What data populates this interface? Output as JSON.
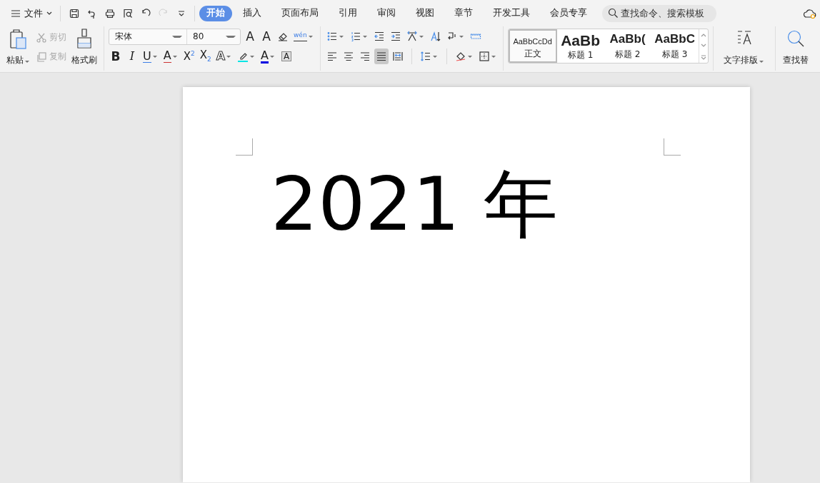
{
  "menu": {
    "label": "文件"
  },
  "quick_access": [
    {
      "kind": "save",
      "disabled": false
    },
    {
      "kind": "share",
      "disabled": false
    },
    {
      "kind": "print",
      "disabled": false
    },
    {
      "kind": "preview",
      "disabled": false
    },
    {
      "kind": "undo",
      "disabled": false
    },
    {
      "kind": "redo",
      "disabled": true
    },
    {
      "kind": "customize",
      "disabled": false
    }
  ],
  "tabs": [
    {
      "label": "开始",
      "selected": true
    },
    {
      "label": "插入",
      "selected": false
    },
    {
      "label": "页面布局",
      "selected": false
    },
    {
      "label": "引用",
      "selected": false
    },
    {
      "label": "审阅",
      "selected": false
    },
    {
      "label": "视图",
      "selected": false
    },
    {
      "label": "章节",
      "selected": false
    },
    {
      "label": "开发工具",
      "selected": false
    },
    {
      "label": "会员专享",
      "selected": false
    }
  ],
  "search": {
    "placeholder": "查找命令、搜索模板"
  },
  "clipboard": {
    "paste": "粘贴",
    "cut": {
      "label": "剪切",
      "disabled": true
    },
    "copy": {
      "label": "复制",
      "disabled": true
    },
    "format_painter": "格式刷"
  },
  "font": {
    "name": "宋体",
    "size": "80"
  },
  "font_tools": [
    [
      {
        "kind": "grow",
        "glyph": "A",
        "dropdown": false
      },
      {
        "kind": "shrink",
        "glyph": "A",
        "dropdown": false
      },
      {
        "kind": "eraser",
        "dropdown": false
      },
      {
        "kind": "pinyin",
        "glyph": "wén",
        "dropdown": true
      }
    ],
    [
      {
        "kind": "bold",
        "glyph": "B",
        "dropdown": false
      },
      {
        "kind": "italic",
        "glyph": "I",
        "dropdown": false
      },
      {
        "kind": "underline",
        "glyph": "U",
        "dropdown": true
      },
      {
        "kind": "strike",
        "glyph": "A",
        "dropdown": true
      },
      {
        "kind": "super",
        "glyph": "X$^{2}$",
        "dropdown": false
      },
      {
        "kind": "sub",
        "glyph": "X$_{2}$",
        "dropdown": false
      },
      {
        "kind": "outline",
        "glyph": "A",
        "dropdown": true
      },
      {
        "kind": "highlight",
        "dropdown": true
      },
      {
        "kind": "color",
        "glyph": "A",
        "dropdown": true
      },
      {
        "kind": "shade",
        "glyph": "A",
        "dropdown": false
      }
    ]
  ],
  "paragraph_tools": [
    [
      {
        "kind": "bullets",
        "dropdown": true,
        "selected": false
      },
      {
        "kind": "numbering",
        "dropdown": true,
        "selected": false
      },
      {
        "kind": "outdent",
        "dropdown": false,
        "selected": false
      },
      {
        "kind": "indent",
        "dropdown": false,
        "selected": false
      },
      {
        "kind": "asian",
        "dropdown": true,
        "selected": false
      },
      {
        "kind": "sort",
        "dropdown": false,
        "selected": false
      },
      {
        "kind": "marks",
        "dropdown": true,
        "selected": false
      },
      {
        "kind": "ruler",
        "dropdown": false,
        "selected": false
      }
    ],
    [
      {
        "kind": "left",
        "dropdown": false,
        "selected": false
      },
      {
        "kind": "center",
        "dropdown": false,
        "selected": false
      },
      {
        "kind": "right",
        "dropdown": false,
        "selected": false
      },
      {
        "kind": "justify",
        "dropdown": false,
        "selected": true
      },
      {
        "kind": "distribute",
        "dropdown": false,
        "selected": false
      },
      {
        "kind": "spacing",
        "dropdown": true,
        "selected": false
      },
      {
        "kind": "fill",
        "dropdown": true,
        "selected": false
      },
      {
        "kind": "borders",
        "dropdown": true,
        "selected": false
      }
    ]
  ],
  "styles": [
    {
      "sample": "AaBbCcDd",
      "label": "正文",
      "selected": true
    },
    {
      "sample": "AaBb",
      "label": "标题 1",
      "selected": false
    },
    {
      "sample": "AaBb(",
      "label": "标题 2",
      "selected": false
    },
    {
      "sample": "AaBbC",
      "label": "标题 3",
      "selected": false
    }
  ],
  "text_layout": {
    "label": "文字排版"
  },
  "find_replace": {
    "label": "查找替"
  },
  "document": {
    "text": "2021 年"
  }
}
